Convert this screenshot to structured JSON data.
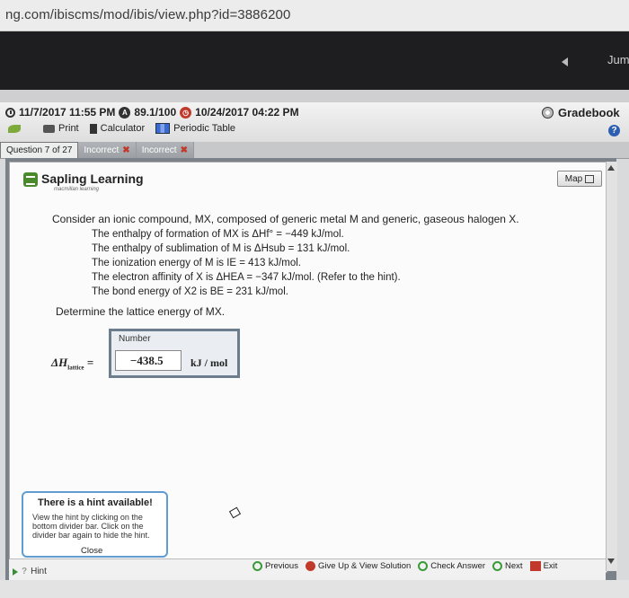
{
  "browser": {
    "url": "ng.com/ibiscms/mod/ibis/view.php?id=3886200",
    "jump_label": "Jum"
  },
  "header": {
    "opened": "11/7/2017 11:55 PM",
    "score": "89.1/100",
    "due": "10/24/2017 04:22 PM",
    "score_icon": "A",
    "gradebook_label": "Gradebook",
    "help_label": "?",
    "tools": {
      "print": "Print",
      "calculator": "Calculator",
      "periodic_table": "Periodic Table"
    }
  },
  "tabs": [
    {
      "label": "Question 7 of 27"
    },
    {
      "label": "Incorrect"
    },
    {
      "label": "Incorrect"
    }
  ],
  "brand": {
    "name": "Sapling Learning",
    "sub": "macmillan learning"
  },
  "map_label": "Map",
  "question": {
    "intro": "Consider an ionic compound, MX, composed of generic metal M and generic, gaseous halogen X.",
    "lines": [
      "The enthalpy of formation of MX is ΔHf° = −449 kJ/mol.",
      "The enthalpy of sublimation of M is ΔHsub = 131 kJ/mol.",
      "The ionization energy of M is IE = 413 kJ/mol.",
      "The electron affinity of X is ΔHEA = −347 kJ/mol. (Refer to the hint).",
      "The bond energy of X2 is BE = 231 kJ/mol."
    ],
    "determine": "Determine the lattice energy of MX."
  },
  "answer": {
    "number_label": "Number",
    "symbol": "ΔH",
    "symbol_sub": "lattice",
    "equals": "=",
    "value": "−438.5",
    "unit": "kJ / mol"
  },
  "hint": {
    "title": "There is a hint available!",
    "body": "View the hint by clicking on the bottom divider bar. Click on the divider bar again to hide the hint.",
    "close": "Close",
    "toggle": "Hint"
  },
  "nav": {
    "previous": "Previous",
    "give_up": "Give Up & View Solution",
    "check": "Check Answer",
    "next": "Next",
    "exit": "Exit"
  }
}
